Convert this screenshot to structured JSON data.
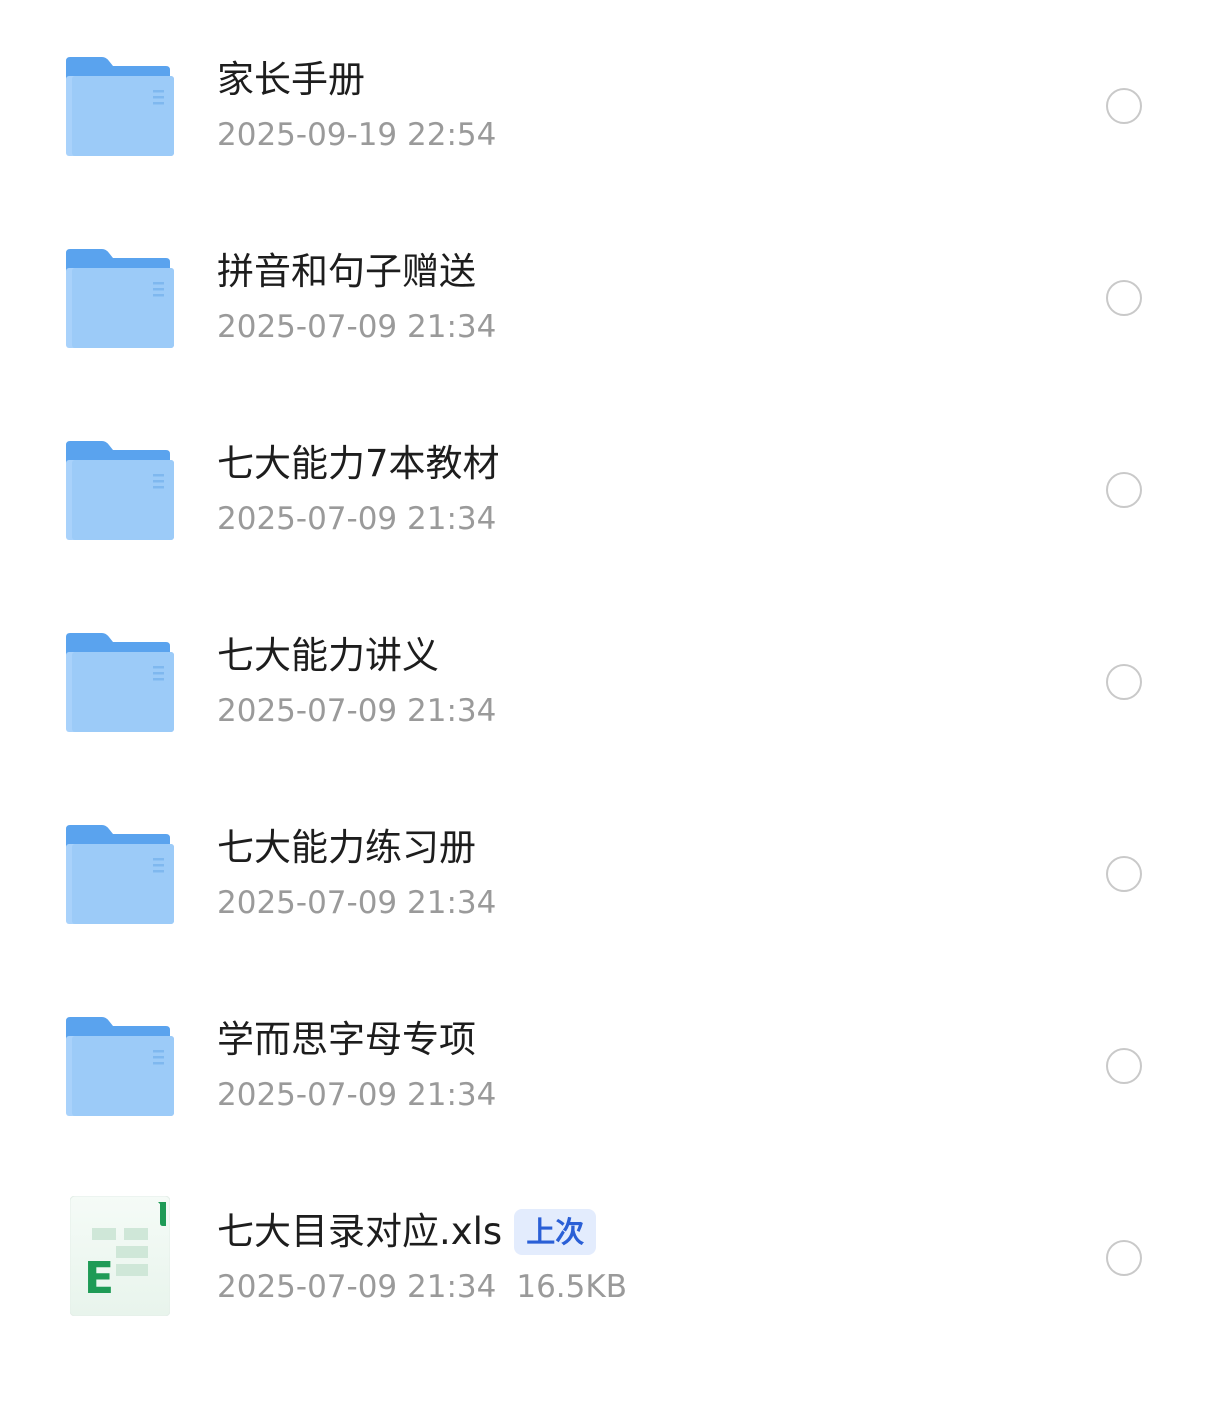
{
  "items": [
    {
      "type": "folder",
      "icon": "folder-icon",
      "name": "家长手册",
      "datetime": "2025-09-19 22:54"
    },
    {
      "type": "folder",
      "icon": "folder-icon",
      "name": "拼音和句子赠送",
      "datetime": "2025-07-09 21:34"
    },
    {
      "type": "folder",
      "icon": "folder-icon",
      "name": "七大能力7本教材",
      "datetime": "2025-07-09 21:34"
    },
    {
      "type": "folder",
      "icon": "folder-icon",
      "name": "七大能力讲义",
      "datetime": "2025-07-09 21:34"
    },
    {
      "type": "folder",
      "icon": "folder-icon",
      "name": "七大能力练习册",
      "datetime": "2025-07-09 21:34"
    },
    {
      "type": "folder",
      "icon": "folder-icon",
      "name": "学而思字母专项",
      "datetime": "2025-07-09 21:34"
    },
    {
      "type": "file",
      "icon": "excel-file-icon",
      "name": "七大目录对应.xls",
      "badge": "上次",
      "datetime": "2025-07-09 21:34",
      "size": "16.5KB"
    }
  ],
  "colors": {
    "folder": "#7cbcf4",
    "excel": "#1e9b56",
    "badge_bg": "#e3ecfd",
    "badge_text": "#2a5fd6",
    "meta_text": "#9a9a9a"
  }
}
